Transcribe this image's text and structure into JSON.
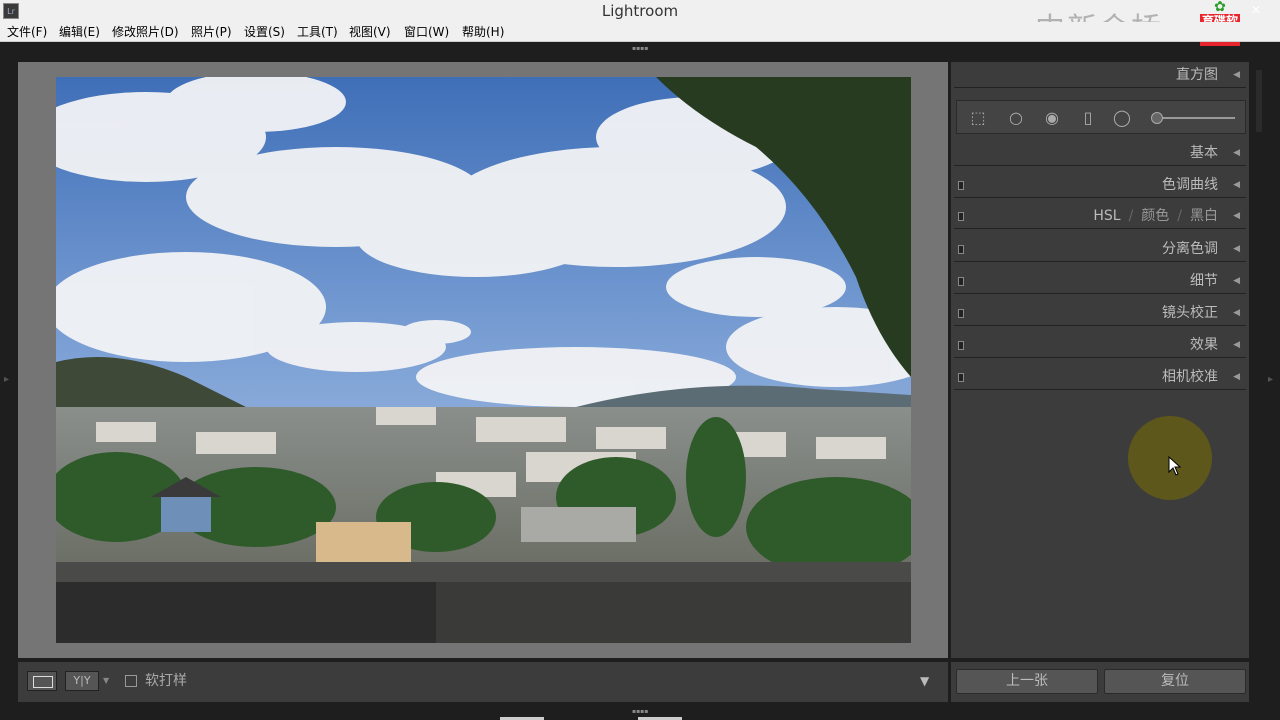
{
  "window": {
    "app_icon": "Lr",
    "title": "Lightroom",
    "watermark": "中新金桥",
    "logo_text": "育碟软件",
    "close": "✕"
  },
  "menu": [
    "文件(F)",
    "编辑(E)",
    "修改照片(D)",
    "照片(P)",
    "设置(S)",
    "工具(T)",
    "视图(V)",
    "窗口(W)",
    "帮助(H)"
  ],
  "right_panel": {
    "histogram": "直方图",
    "basic": "基本",
    "tone_curve": "色调曲线",
    "hsl": "HSL",
    "color": "颜色",
    "bw": "黑白",
    "split_toning": "分离色调",
    "detail": "细节",
    "lens": "镜头校正",
    "effects": "效果",
    "camera_calibration": "相机校准"
  },
  "toolbar": {
    "yy_label": "Y|Y",
    "soft_proof": "软打样"
  },
  "buttons": {
    "previous": "上一张",
    "reset": "复位"
  },
  "icons": {
    "crop": "crop-overlay-icon",
    "spot": "spot-removal-icon",
    "redeye": "red-eye-icon",
    "graduated": "graduated-filter-icon",
    "radial": "radial-filter-icon",
    "brush": "adjustment-brush-icon"
  }
}
